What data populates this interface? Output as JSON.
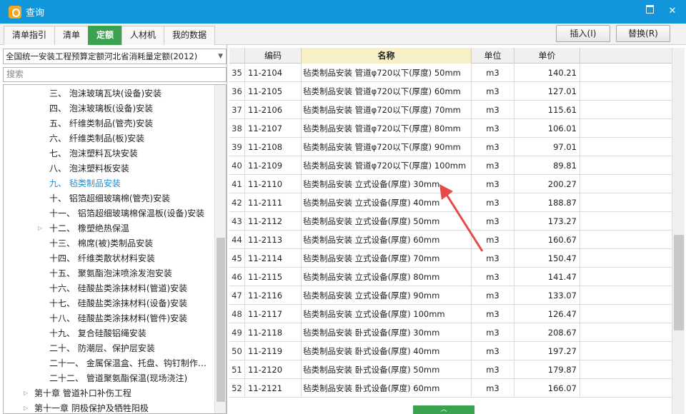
{
  "window": {
    "title": "查询"
  },
  "tabs": [
    {
      "label": "清单指引"
    },
    {
      "label": "清单"
    },
    {
      "label": "定额",
      "active": true
    },
    {
      "label": "人材机"
    },
    {
      "label": "我的数据"
    }
  ],
  "toolbar": {
    "insert_label": "插入(I)",
    "replace_label": "替换(R)"
  },
  "left": {
    "standard_select": "全国统一安装工程预算定额河北省消耗量定额(2012)",
    "search_placeholder": "搜索",
    "tree": [
      {
        "label": "三、 泡沫玻璃瓦块(设备)安装",
        "depth": 2
      },
      {
        "label": "四、 泡沫玻璃板(设备)安装",
        "depth": 2
      },
      {
        "label": "五、 纤维类制品(管壳)安装",
        "depth": 2
      },
      {
        "label": "六、 纤维类制品(板)安装",
        "depth": 2
      },
      {
        "label": "七、 泡沫塑料瓦块安装",
        "depth": 2
      },
      {
        "label": "八、 泡沫塑料板安装",
        "depth": 2
      },
      {
        "label": "九、 毡类制品安装",
        "depth": 2,
        "selected": true
      },
      {
        "label": "十、 铝箔超细玻璃棉(管壳)安装",
        "depth": 2
      },
      {
        "label": "十一、 铝箔超细玻璃棉保温板(设备)安装",
        "depth": 2
      },
      {
        "label": "十二、 橡塑绝热保温",
        "depth": 2,
        "expandable": true
      },
      {
        "label": "十三、 棉席(被)类制品安装",
        "depth": 2
      },
      {
        "label": "十四、 纤维类散状材料安装",
        "depth": 2
      },
      {
        "label": "十五、 聚氨酯泡沫喷涂发泡安装",
        "depth": 2
      },
      {
        "label": "十六、 硅酸盐类涂抹材料(管道)安装",
        "depth": 2
      },
      {
        "label": "十七、 硅酸盐类涂抹材料(设备)安装",
        "depth": 2
      },
      {
        "label": "十八、 硅酸盐类涂抹材料(管件)安装",
        "depth": 2
      },
      {
        "label": "十九、 复合硅酸铝绳安装",
        "depth": 2
      },
      {
        "label": "二十、 防潮层、保护层安装",
        "depth": 2
      },
      {
        "label": "二十一、 金属保温盒、托盘、钩钉制作…",
        "depth": 2
      },
      {
        "label": "二十二、 管道聚氨酯保温(现场浇注)",
        "depth": 2
      },
      {
        "label": "第十章 管道补口补伤工程",
        "depth": 1,
        "expandable": true
      },
      {
        "label": "第十一章 阴极保护及牺牲阳极",
        "depth": 1,
        "expandable": true
      }
    ]
  },
  "grid": {
    "columns": {
      "code": "编码",
      "name": "名称",
      "unit": "单位",
      "price": "单价"
    },
    "rows": [
      {
        "num": "35",
        "code": "11-2104",
        "name": "毡类制品安装 管道φ720以下(厚度) 50mm",
        "unit": "m3",
        "price": "140.21"
      },
      {
        "num": "36",
        "code": "11-2105",
        "name": "毡类制品安装 管道φ720以下(厚度) 60mm",
        "unit": "m3",
        "price": "127.01"
      },
      {
        "num": "37",
        "code": "11-2106",
        "name": "毡类制品安装 管道φ720以下(厚度) 70mm",
        "unit": "m3",
        "price": "115.61"
      },
      {
        "num": "38",
        "code": "11-2107",
        "name": "毡类制品安装 管道φ720以下(厚度) 80mm",
        "unit": "m3",
        "price": "106.01"
      },
      {
        "num": "39",
        "code": "11-2108",
        "name": "毡类制品安装 管道φ720以下(厚度) 90mm",
        "unit": "m3",
        "price": "97.01"
      },
      {
        "num": "40",
        "code": "11-2109",
        "name": "毡类制品安装 管道φ720以下(厚度) 100mm",
        "unit": "m3",
        "price": "89.81"
      },
      {
        "num": "41",
        "code": "11-2110",
        "name": "毡类制品安装 立式设备(厚度) 30mm",
        "unit": "m3",
        "price": "200.27"
      },
      {
        "num": "42",
        "code": "11-2111",
        "name": "毡类制品安装 立式设备(厚度) 40mm",
        "unit": "m3",
        "price": "188.87"
      },
      {
        "num": "43",
        "code": "11-2112",
        "name": "毡类制品安装 立式设备(厚度) 50mm",
        "unit": "m3",
        "price": "173.27"
      },
      {
        "num": "44",
        "code": "11-2113",
        "name": "毡类制品安装 立式设备(厚度) 60mm",
        "unit": "m3",
        "price": "160.67"
      },
      {
        "num": "45",
        "code": "11-2114",
        "name": "毡类制品安装 立式设备(厚度) 70mm",
        "unit": "m3",
        "price": "150.47"
      },
      {
        "num": "46",
        "code": "11-2115",
        "name": "毡类制品安装 立式设备(厚度) 80mm",
        "unit": "m3",
        "price": "141.47"
      },
      {
        "num": "47",
        "code": "11-2116",
        "name": "毡类制品安装 立式设备(厚度) 90mm",
        "unit": "m3",
        "price": "133.07"
      },
      {
        "num": "48",
        "code": "11-2117",
        "name": "毡类制品安装 立式设备(厚度) 100mm",
        "unit": "m3",
        "price": "126.47"
      },
      {
        "num": "49",
        "code": "11-2118",
        "name": "毡类制品安装 卧式设备(厚度) 30mm",
        "unit": "m3",
        "price": "208.67"
      },
      {
        "num": "50",
        "code": "11-2119",
        "name": "毡类制品安装 卧式设备(厚度) 40mm",
        "unit": "m3",
        "price": "197.27"
      },
      {
        "num": "51",
        "code": "11-2120",
        "name": "毡类制品安装 卧式设备(厚度) 50mm",
        "unit": "m3",
        "price": "179.87"
      },
      {
        "num": "52",
        "code": "11-2121",
        "name": "毡类制品安装 卧式设备(厚度) 60mm",
        "unit": "m3",
        "price": "166.07"
      }
    ]
  },
  "colors": {
    "titlebar": "#1296db",
    "active_tab": "#3ba24f",
    "selected_tree": "#1a8fd6",
    "annotation_arrow": "#e84a4a"
  }
}
